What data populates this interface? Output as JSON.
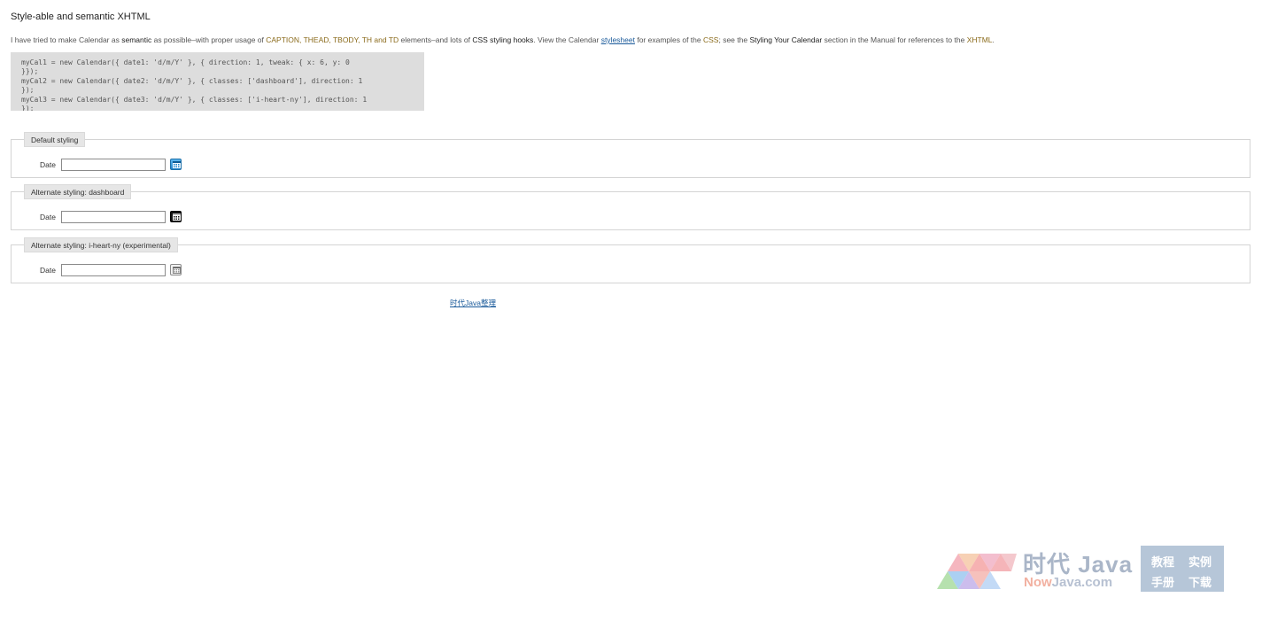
{
  "heading": "Style-able and semantic XHTML",
  "intro": {
    "p1": "I have tried to make Calendar as ",
    "semantic": "semantic",
    "p2": " as possible–with proper usage of ",
    "tags": "CAPTION, THEAD, TBODY, TH and TD",
    "p3": " elements–and lots of ",
    "hooks": "CSS styling hooks",
    "p4": ". View the Calendar ",
    "stylesheet_link": "stylesheet",
    "p5": " for examples of the ",
    "css": "CSS",
    "p6": "; see the ",
    "styling_section": "Styling Your Calendar",
    "p7": " section in the Manual for references to the ",
    "xhtml": "XHTML",
    "p8": "."
  },
  "code_sample": "myCal1 = new Calendar({ date1: 'd/m/Y' }, { direction: 1, tweak: { x: 6, y: 0\n}});\nmyCal2 = new Calendar({ date2: 'd/m/Y' }, { classes: ['dashboard'], direction: 1\n});\nmyCal3 = new Calendar({ date3: 'd/m/Y' }, { classes: ['i-heart-ny'], direction: 1\n});",
  "demos": [
    {
      "legend": "Default styling",
      "field_label": "Date",
      "value": "",
      "button_style": "blue",
      "icon": "calendar-icon"
    },
    {
      "legend": "Alternate styling: dashboard",
      "field_label": "Date",
      "value": "",
      "button_style": "black",
      "icon": "calendar-icon"
    },
    {
      "legend": "Alternate styling: i-heart-ny (experimental)",
      "field_label": "Date",
      "value": "",
      "button_style": "gray",
      "icon": "calendar-icon"
    }
  ],
  "footer_link": "时代Java整理",
  "watermark": {
    "brand": "时代 Java",
    "domain_now": "Now",
    "domain_rest": "Java.com",
    "menu": [
      "教程",
      "实例",
      "手册",
      "下载"
    ]
  },
  "colors": {
    "accent_text": "#8a6a1a",
    "link": "#1a5a9a",
    "code_bg": "#dddddd",
    "legend_bg": "#e6e6e6"
  }
}
